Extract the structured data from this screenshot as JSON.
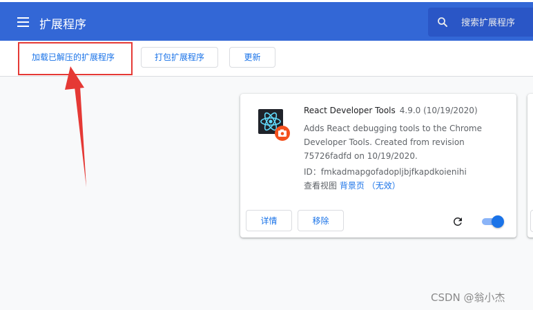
{
  "header": {
    "title": "扩展程序",
    "search_placeholder": "搜索扩展程序"
  },
  "toolbar": {
    "load_unpacked": "加载已解压的扩展程序",
    "pack": "打包扩展程序",
    "update": "更新"
  },
  "extension": {
    "name": "React Developer Tools",
    "version": "4.9.0 (10/19/2020)",
    "description": "Adds React debugging tools to the Chrome Developer Tools. Created from revision 75726fadfd on 10/19/2020.",
    "id_label": "ID：",
    "id_value": "fmkadmapgofadopljbjfkapdkoienihi",
    "views_label": "查看视图",
    "views_link": "背景页",
    "views_status": "（无效）",
    "details_button": "详情",
    "remove_button": "移除",
    "enabled": true
  },
  "colors": {
    "header_bg": "#3367d6",
    "accent": "#1a73e8",
    "highlight": "#e53935"
  },
  "watermark": "CSDN @翁小杰"
}
